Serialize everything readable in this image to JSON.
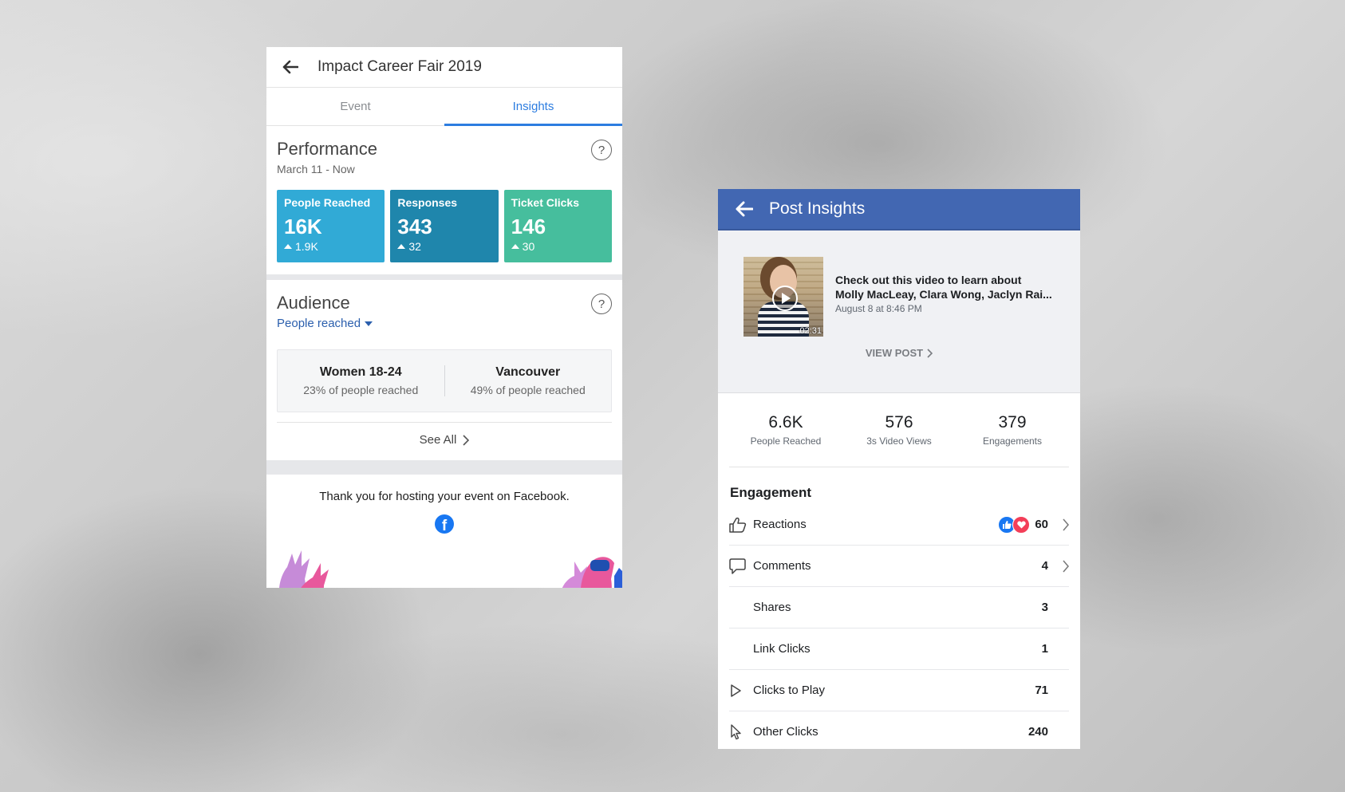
{
  "event": {
    "title": "Impact Career Fair 2019",
    "tabs": [
      "Event",
      "Insights"
    ],
    "active_tab": "Insights",
    "performance": {
      "title": "Performance",
      "date_range": "March 11 - Now",
      "stats": [
        {
          "label": "People Reached",
          "value": "16K",
          "delta": "1.9K",
          "color": "#31aad6"
        },
        {
          "label": "Responses",
          "value": "343",
          "delta": "32",
          "color": "#1f86ac"
        },
        {
          "label": "Ticket Clicks",
          "value": "146",
          "delta": "30",
          "color": "#46be9d"
        }
      ]
    },
    "audience": {
      "title": "Audience",
      "dropdown": "People reached",
      "items": [
        {
          "main": "Women 18-24",
          "sub": "23% of people reached"
        },
        {
          "main": "Vancouver",
          "sub": "49% of people reached"
        }
      ],
      "see_all": "See All"
    },
    "footer": {
      "thanks": "Thank you for hosting your event on Facebook.",
      "logo_letter": "f"
    },
    "help_symbol": "?"
  },
  "post": {
    "title": "Post Insights",
    "preview": {
      "line1": "Check out this video to learn about",
      "line2": "Molly MacLeay, Clara Wong, Jaclyn Rai...",
      "date": "August 8 at 8:46 PM",
      "duration": "02:31",
      "view_post": "VIEW POST"
    },
    "metrics": [
      {
        "value": "6.6K",
        "label": "People Reached"
      },
      {
        "value": "576",
        "label": "3s Video Views"
      },
      {
        "value": "379",
        "label": "Engagements"
      }
    ],
    "engagement_title": "Engagement",
    "engagement": [
      {
        "label": "Reactions",
        "value": "60",
        "icon": "thumbs-up-icon",
        "chevron": true
      },
      {
        "label": "Comments",
        "value": "4",
        "icon": "comment-icon",
        "chevron": true
      },
      {
        "label": "Shares",
        "value": "3",
        "icon": "",
        "chevron": false
      },
      {
        "label": "Link Clicks",
        "value": "1",
        "icon": "",
        "chevron": false
      },
      {
        "label": "Clicks to Play",
        "value": "71",
        "icon": "play-icon",
        "chevron": false
      },
      {
        "label": "Other Clicks",
        "value": "240",
        "icon": "cursor-icon",
        "chevron": false
      }
    ]
  },
  "colors": {
    "facebook_blue": "#4267b2",
    "tab_active": "#2d7de0",
    "link_blue": "#2b5fad",
    "like_blue": "#1877f2",
    "love_red": "#f33e58"
  }
}
